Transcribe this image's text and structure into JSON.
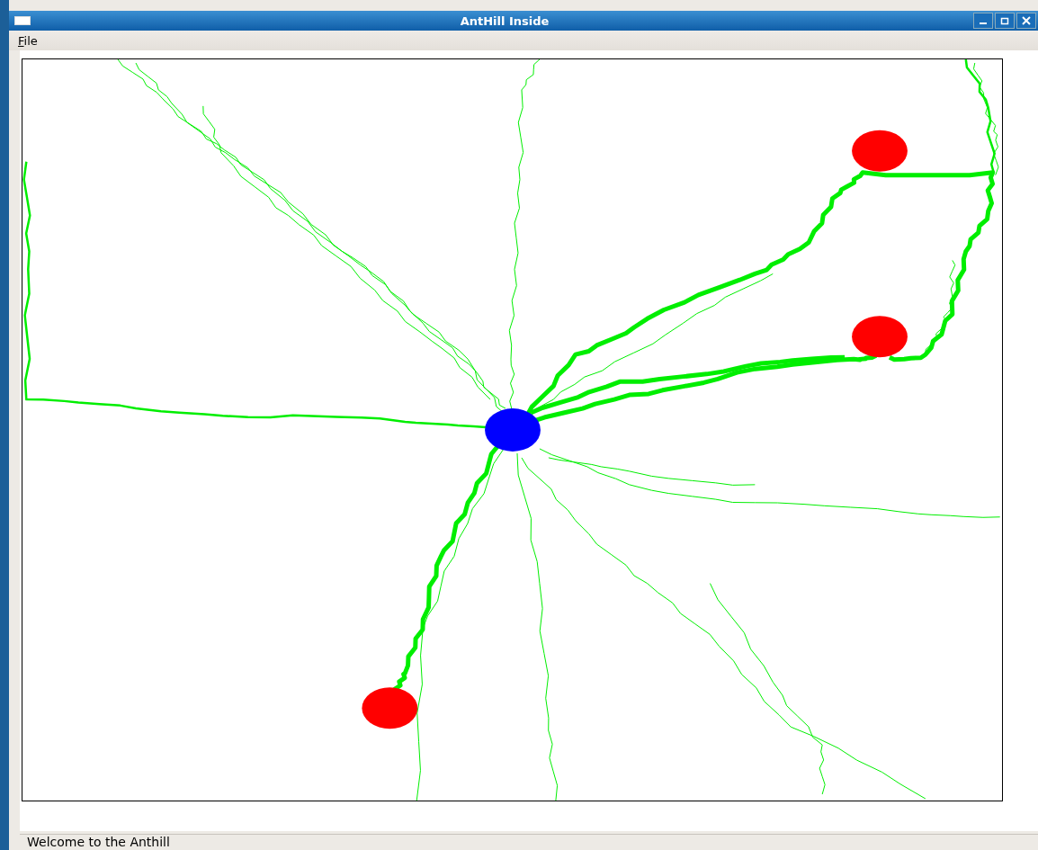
{
  "window": {
    "title": "AntHill Inside"
  },
  "menu": [
    {
      "label": "File"
    }
  ],
  "canvas": {
    "markers": [
      {
        "kind": "nest",
        "color": "#0000ff"
      },
      {
        "kind": "food",
        "color": "#ff0000"
      },
      {
        "kind": "food",
        "color": "#ff0000"
      },
      {
        "kind": "food",
        "color": "#ff0000"
      }
    ]
  },
  "status_bar": "Welcome to the Anthill"
}
